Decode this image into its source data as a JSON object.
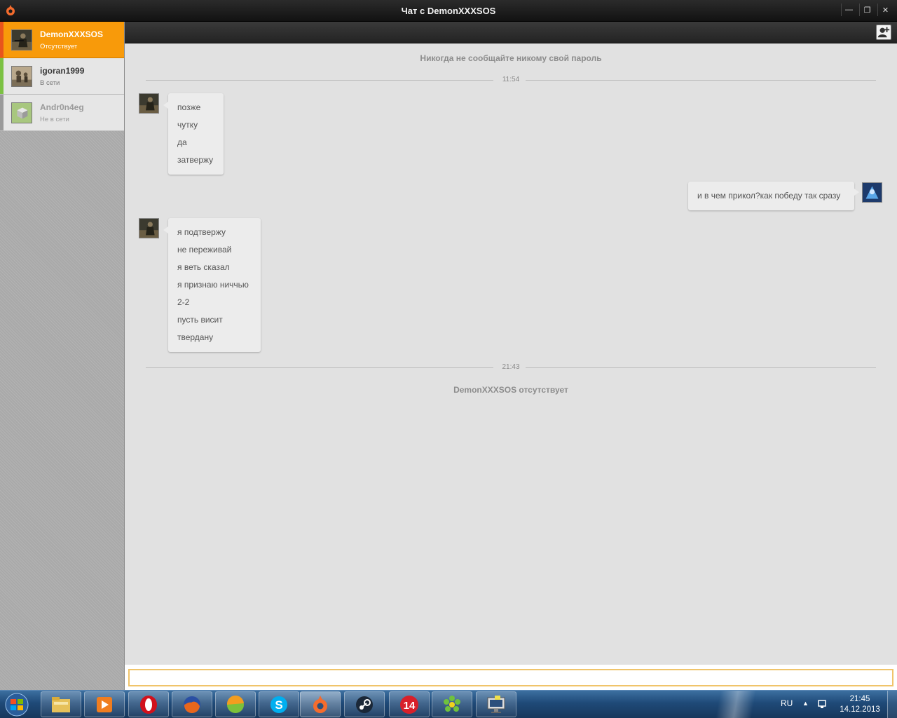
{
  "window": {
    "title": "Чат с DemonXXXSOS",
    "minimize_glyph": "—",
    "restore_glyph": "❐",
    "close_glyph": "✕"
  },
  "contacts": [
    {
      "name": "DemonXXXSOS",
      "status": "Отсутствует",
      "stripe": "#e8541c",
      "active": true
    },
    {
      "name": "igoran1999",
      "status": "В сети",
      "stripe": "#7cc143"
    },
    {
      "name": "Andr0n4eg",
      "status": "Не в сети",
      "stripe": "#9a9a9a"
    }
  ],
  "chat": {
    "notice": "Никогда не сообщайте никому свой пароль",
    "time1": "11:54",
    "group1": [
      "позже",
      "чутку",
      "да",
      "затвержу"
    ],
    "own_message": "и в чем прикол?как победу так сразу",
    "group2": [
      "я подтвержу",
      "не переживай",
      "я веть сказал",
      "я признаю ниччью",
      "2-2",
      "пусть висит",
      "твердану"
    ],
    "time2": "21:43",
    "away_note": "DemonXXXSOS отсутствует"
  },
  "input": {
    "value": "",
    "placeholder": ""
  },
  "taskbar": {
    "apps": [
      "explorer",
      "media-player",
      "opera",
      "firefox",
      "vector-app",
      "skype",
      "origin",
      "steam",
      "app-14",
      "icq",
      "monitor"
    ],
    "app14_label": "14",
    "skype_letter": "S",
    "language": "RU",
    "time": "21:45",
    "date": "14.12.2013"
  },
  "colors": {
    "accent": "#f89a0a",
    "online": "#7cc143",
    "away": "#e8541c"
  }
}
